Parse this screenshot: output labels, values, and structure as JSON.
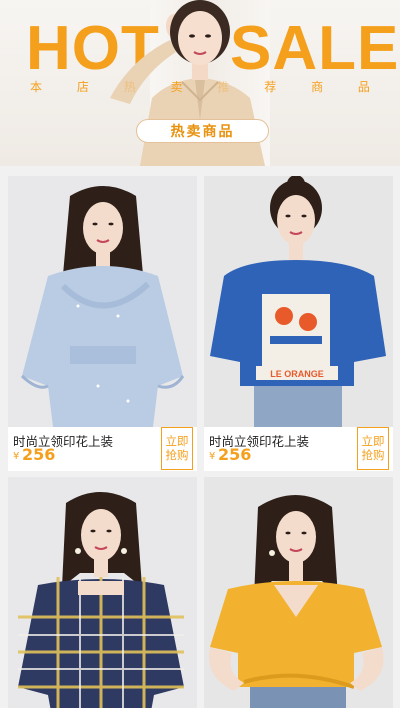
{
  "banner": {
    "title_left": "HOT",
    "title_right": "SALE",
    "subtitle_chars": [
      "本",
      "店",
      "热",
      "卖",
      "推",
      "荐",
      "商",
      "品"
    ],
    "badge": "热卖商品"
  },
  "colors": {
    "accent": "#f5a01c",
    "page_bg": "#f1f1f1",
    "card_bg": "#ffffff"
  },
  "products": [
    {
      "name": "时尚立领印花上装",
      "currency": "¥",
      "price": "256",
      "buy_line1": "立即",
      "buy_line2": "抢购"
    },
    {
      "name": "时尚立领印花上装",
      "currency": "¥",
      "price": "256",
      "buy_line1": "立即",
      "buy_line2": "抢购"
    },
    {
      "name": "",
      "currency": "",
      "price": "",
      "buy_line1": "",
      "buy_line2": ""
    },
    {
      "name": "",
      "currency": "",
      "price": "",
      "buy_line1": "",
      "buy_line2": ""
    }
  ]
}
